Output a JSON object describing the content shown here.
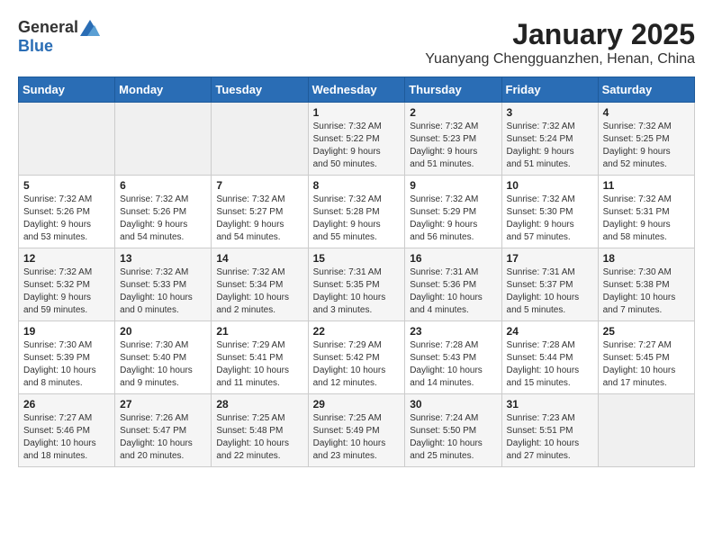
{
  "logo": {
    "general": "General",
    "blue": "Blue"
  },
  "title": "January 2025",
  "location": "Yuanyang Chengguanzhen, Henan, China",
  "days_of_week": [
    "Sunday",
    "Monday",
    "Tuesday",
    "Wednesday",
    "Thursday",
    "Friday",
    "Saturday"
  ],
  "weeks": [
    [
      {
        "day": "",
        "info": ""
      },
      {
        "day": "",
        "info": ""
      },
      {
        "day": "",
        "info": ""
      },
      {
        "day": "1",
        "info": "Sunrise: 7:32 AM\nSunset: 5:22 PM\nDaylight: 9 hours\nand 50 minutes."
      },
      {
        "day": "2",
        "info": "Sunrise: 7:32 AM\nSunset: 5:23 PM\nDaylight: 9 hours\nand 51 minutes."
      },
      {
        "day": "3",
        "info": "Sunrise: 7:32 AM\nSunset: 5:24 PM\nDaylight: 9 hours\nand 51 minutes."
      },
      {
        "day": "4",
        "info": "Sunrise: 7:32 AM\nSunset: 5:25 PM\nDaylight: 9 hours\nand 52 minutes."
      }
    ],
    [
      {
        "day": "5",
        "info": "Sunrise: 7:32 AM\nSunset: 5:26 PM\nDaylight: 9 hours\nand 53 minutes."
      },
      {
        "day": "6",
        "info": "Sunrise: 7:32 AM\nSunset: 5:26 PM\nDaylight: 9 hours\nand 54 minutes."
      },
      {
        "day": "7",
        "info": "Sunrise: 7:32 AM\nSunset: 5:27 PM\nDaylight: 9 hours\nand 54 minutes."
      },
      {
        "day": "8",
        "info": "Sunrise: 7:32 AM\nSunset: 5:28 PM\nDaylight: 9 hours\nand 55 minutes."
      },
      {
        "day": "9",
        "info": "Sunrise: 7:32 AM\nSunset: 5:29 PM\nDaylight: 9 hours\nand 56 minutes."
      },
      {
        "day": "10",
        "info": "Sunrise: 7:32 AM\nSunset: 5:30 PM\nDaylight: 9 hours\nand 57 minutes."
      },
      {
        "day": "11",
        "info": "Sunrise: 7:32 AM\nSunset: 5:31 PM\nDaylight: 9 hours\nand 58 minutes."
      }
    ],
    [
      {
        "day": "12",
        "info": "Sunrise: 7:32 AM\nSunset: 5:32 PM\nDaylight: 9 hours\nand 59 minutes."
      },
      {
        "day": "13",
        "info": "Sunrise: 7:32 AM\nSunset: 5:33 PM\nDaylight: 10 hours\nand 0 minutes."
      },
      {
        "day": "14",
        "info": "Sunrise: 7:32 AM\nSunset: 5:34 PM\nDaylight: 10 hours\nand 2 minutes."
      },
      {
        "day": "15",
        "info": "Sunrise: 7:31 AM\nSunset: 5:35 PM\nDaylight: 10 hours\nand 3 minutes."
      },
      {
        "day": "16",
        "info": "Sunrise: 7:31 AM\nSunset: 5:36 PM\nDaylight: 10 hours\nand 4 minutes."
      },
      {
        "day": "17",
        "info": "Sunrise: 7:31 AM\nSunset: 5:37 PM\nDaylight: 10 hours\nand 5 minutes."
      },
      {
        "day": "18",
        "info": "Sunrise: 7:30 AM\nSunset: 5:38 PM\nDaylight: 10 hours\nand 7 minutes."
      }
    ],
    [
      {
        "day": "19",
        "info": "Sunrise: 7:30 AM\nSunset: 5:39 PM\nDaylight: 10 hours\nand 8 minutes."
      },
      {
        "day": "20",
        "info": "Sunrise: 7:30 AM\nSunset: 5:40 PM\nDaylight: 10 hours\nand 9 minutes."
      },
      {
        "day": "21",
        "info": "Sunrise: 7:29 AM\nSunset: 5:41 PM\nDaylight: 10 hours\nand 11 minutes."
      },
      {
        "day": "22",
        "info": "Sunrise: 7:29 AM\nSunset: 5:42 PM\nDaylight: 10 hours\nand 12 minutes."
      },
      {
        "day": "23",
        "info": "Sunrise: 7:28 AM\nSunset: 5:43 PM\nDaylight: 10 hours\nand 14 minutes."
      },
      {
        "day": "24",
        "info": "Sunrise: 7:28 AM\nSunset: 5:44 PM\nDaylight: 10 hours\nand 15 minutes."
      },
      {
        "day": "25",
        "info": "Sunrise: 7:27 AM\nSunset: 5:45 PM\nDaylight: 10 hours\nand 17 minutes."
      }
    ],
    [
      {
        "day": "26",
        "info": "Sunrise: 7:27 AM\nSunset: 5:46 PM\nDaylight: 10 hours\nand 18 minutes."
      },
      {
        "day": "27",
        "info": "Sunrise: 7:26 AM\nSunset: 5:47 PM\nDaylight: 10 hours\nand 20 minutes."
      },
      {
        "day": "28",
        "info": "Sunrise: 7:25 AM\nSunset: 5:48 PM\nDaylight: 10 hours\nand 22 minutes."
      },
      {
        "day": "29",
        "info": "Sunrise: 7:25 AM\nSunset: 5:49 PM\nDaylight: 10 hours\nand 23 minutes."
      },
      {
        "day": "30",
        "info": "Sunrise: 7:24 AM\nSunset: 5:50 PM\nDaylight: 10 hours\nand 25 minutes."
      },
      {
        "day": "31",
        "info": "Sunrise: 7:23 AM\nSunset: 5:51 PM\nDaylight: 10 hours\nand 27 minutes."
      },
      {
        "day": "",
        "info": ""
      }
    ]
  ]
}
